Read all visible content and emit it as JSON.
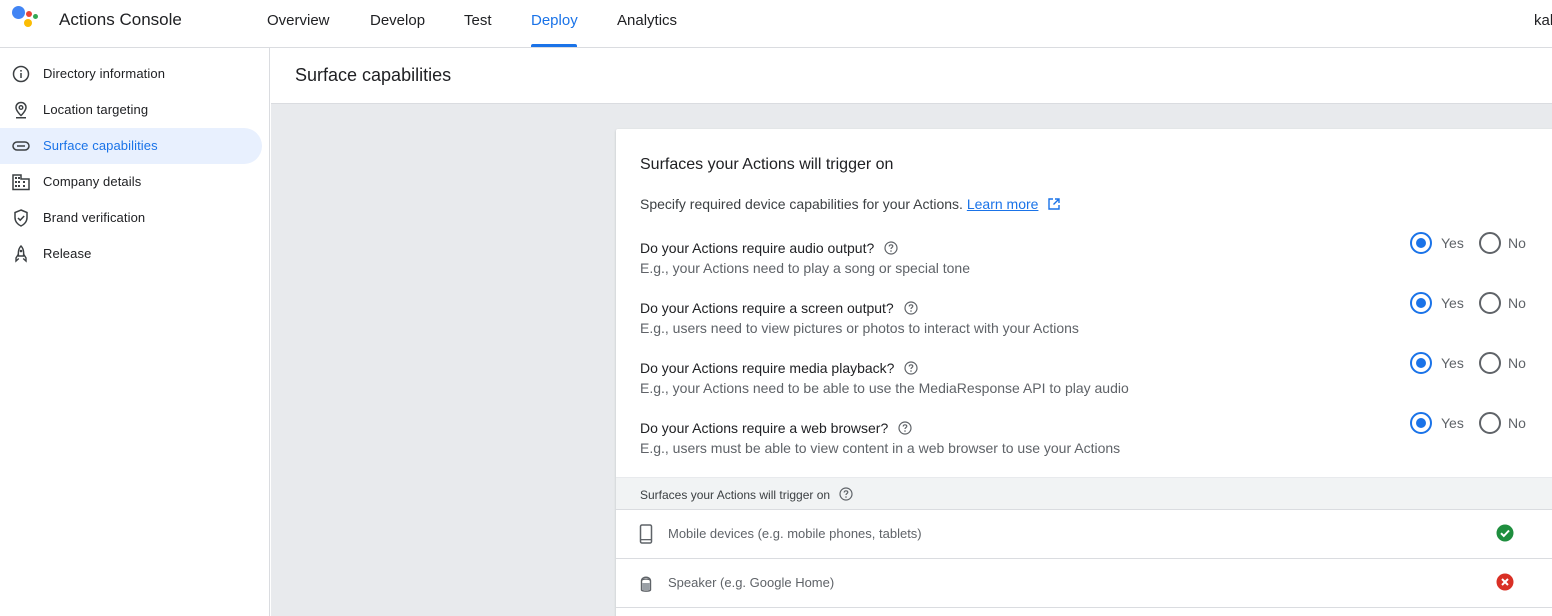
{
  "header": {
    "app_title": "Actions Console",
    "tabs": [
      {
        "label": "Overview"
      },
      {
        "label": "Develop"
      },
      {
        "label": "Test"
      },
      {
        "label": "Deploy",
        "active": true
      },
      {
        "label": "Analytics"
      }
    ],
    "account_text": "kal"
  },
  "sidebar": {
    "items": [
      {
        "label": "Directory information",
        "icon": "info-icon"
      },
      {
        "label": "Location targeting",
        "icon": "location-pin-icon"
      },
      {
        "label": "Surface capabilities",
        "icon": "surface-capsule-icon",
        "active": true
      },
      {
        "label": "Company details",
        "icon": "building-icon"
      },
      {
        "label": "Brand verification",
        "icon": "shield-check-icon"
      },
      {
        "label": "Release",
        "icon": "rocket-icon"
      }
    ]
  },
  "page": {
    "title": "Surface capabilities"
  },
  "card": {
    "title": "Surfaces your Actions will trigger on",
    "description": "Specify required device capabilities for your Actions.",
    "learn_more": "Learn more",
    "yes_label": "Yes",
    "no_label": "No",
    "questions": [
      {
        "question": "Do your Actions require audio output?",
        "hint": "E.g., your Actions need to play a song or special tone",
        "selected": "Yes"
      },
      {
        "question": "Do your Actions require a screen output?",
        "hint": "E.g., users need to view pictures or photos to interact with your Actions",
        "selected": "Yes"
      },
      {
        "question": "Do your Actions require media playback?",
        "hint": "E.g., your Actions need to be able to use the MediaResponse API to play audio",
        "selected": "Yes"
      },
      {
        "question": "Do your Actions require a web browser?",
        "hint": "E.g., users must be able to view content in a web browser to use your Actions",
        "selected": "Yes"
      }
    ],
    "surfaces_header": "Surfaces your Actions will trigger on",
    "surfaces": [
      {
        "label": "Mobile devices (e.g. mobile phones, tablets)",
        "icon": "mobile-phone-icon",
        "status": "supported"
      },
      {
        "label": "Speaker (e.g. Google Home)",
        "icon": "speaker-icon",
        "status": "not-supported"
      }
    ]
  },
  "colors": {
    "accent": "#1a73e8",
    "active_bg": "#e8f0fe",
    "success": "#1e8e3e",
    "error": "#d93025"
  }
}
